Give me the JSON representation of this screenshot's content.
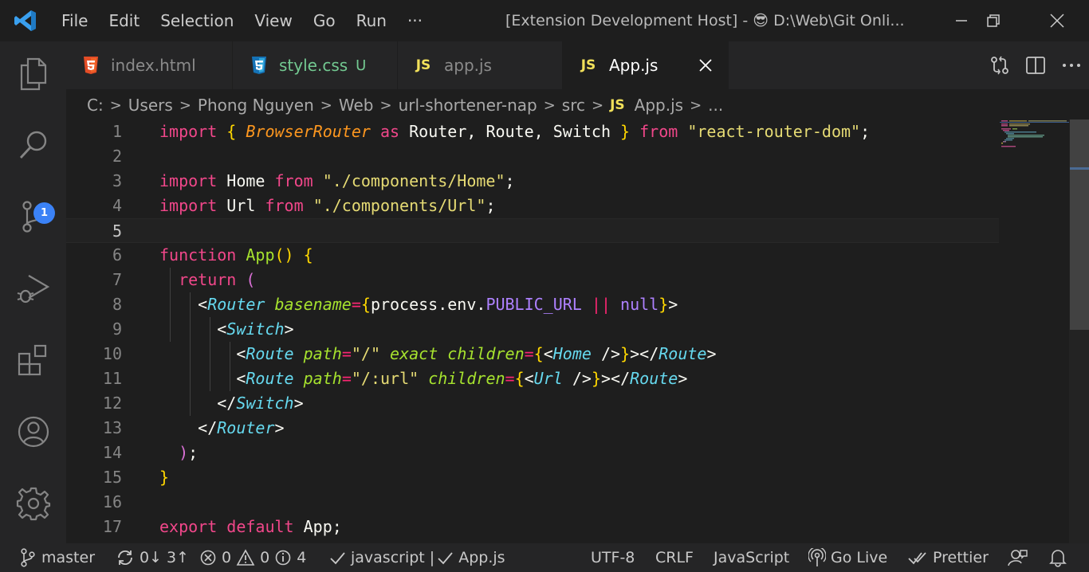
{
  "titlebar": {
    "menu": [
      "File",
      "Edit",
      "Selection",
      "View",
      "Go",
      "Run",
      "···"
    ],
    "window_title_prefix": "[Extension Development Host] - ",
    "window_title_emoji": "😎",
    "window_title_path": " D:\\Web\\Git Onli..."
  },
  "activity_bar": {
    "items": [
      "explorer-icon",
      "search-icon",
      "source-control-icon",
      "run-debug-icon",
      "extensions-icon",
      "accounts-icon",
      "settings-gear-icon"
    ],
    "scm_badge": "1"
  },
  "tabs": [
    {
      "icon": "html5-icon",
      "label": "index.html",
      "status": "",
      "active": false
    },
    {
      "icon": "css3-icon",
      "label": "style.css",
      "status": "U",
      "active": false
    },
    {
      "icon": "JS",
      "label": "app.js",
      "status": "",
      "active": false
    },
    {
      "icon": "JS",
      "label": "App.js",
      "status": "",
      "active": true
    }
  ],
  "breadcrumb": {
    "parts": [
      "C:",
      "Users",
      "Phong Nguyen",
      "Web",
      "url-shortener-nap",
      "src"
    ],
    "file_icon": "JS",
    "file": "App.js",
    "more": "..."
  },
  "editor": {
    "current_line": 5,
    "lines": [
      {
        "n": "1"
      },
      {
        "n": "2"
      },
      {
        "n": "3"
      },
      {
        "n": "4"
      },
      {
        "n": "5"
      },
      {
        "n": "6"
      },
      {
        "n": "7"
      },
      {
        "n": "8"
      },
      {
        "n": "9"
      },
      {
        "n": "10"
      },
      {
        "n": "11"
      },
      {
        "n": "12"
      },
      {
        "n": "13"
      },
      {
        "n": "14"
      },
      {
        "n": "15"
      },
      {
        "n": "16"
      },
      {
        "n": "17"
      }
    ],
    "tokens": {
      "l1": [
        "import",
        " ",
        "{",
        " ",
        "BrowserRouter",
        " ",
        "as",
        " Router, Route, Switch ",
        "}",
        " ",
        "from",
        " ",
        "\"react-router-dom\"",
        ";"
      ],
      "l3": [
        "import",
        " Home ",
        "from",
        " ",
        "\"./components/Home\"",
        ";"
      ],
      "l4": [
        "import",
        " Url ",
        "from",
        " ",
        "\"./components/Url\"",
        ";"
      ],
      "l6": [
        "function",
        " ",
        "App",
        "()",
        " ",
        "{"
      ],
      "l7": [
        "return",
        " ",
        "("
      ],
      "l8": [
        "<",
        "Router",
        " ",
        "basename",
        "=",
        "{",
        "process.env.",
        "PUBLIC_URL",
        " ",
        "||",
        " ",
        "null",
        "}",
        ">"
      ],
      "l9": [
        "<",
        "Switch",
        ">"
      ],
      "l10": [
        "<",
        "Route",
        " ",
        "path",
        "=",
        "\"/\"",
        " ",
        "exact",
        " ",
        "children",
        "=",
        "{",
        "<",
        "Home",
        " ",
        "/>",
        "}",
        "></",
        "Route",
        ">"
      ],
      "l11": [
        "<",
        "Route",
        " ",
        "path",
        "=",
        "\"/:url\"",
        " ",
        "children",
        "=",
        "{",
        "<",
        "Url",
        " ",
        "/>",
        "}",
        "></",
        "Route",
        ">"
      ],
      "l12": [
        "</",
        "Switch",
        ">"
      ],
      "l13": [
        "</",
        "Router",
        ">"
      ],
      "l14": [
        ")",
        ";"
      ],
      "l15": [
        "}"
      ],
      "l17": [
        "export",
        " ",
        "default",
        " App;"
      ]
    }
  },
  "statusbar": {
    "branch": "master",
    "sync": "0↓ 3↑",
    "errors": "0",
    "warnings": "0",
    "infos": "4",
    "eslint": "javascript | ",
    "eslint_file": "App.js",
    "encoding": "UTF-8",
    "eol": "CRLF",
    "language": "JavaScript",
    "golive": "Go Live",
    "prettier": "Prettier"
  },
  "colors": {
    "keyword": "#f1478a",
    "function": "#a6e22e",
    "string": "#e6db74",
    "jsx_tag": "#66d9ef",
    "bracket_gold": "#ffd700",
    "bracket_orchid": "#da70d6",
    "badge": "#3b82f6"
  }
}
